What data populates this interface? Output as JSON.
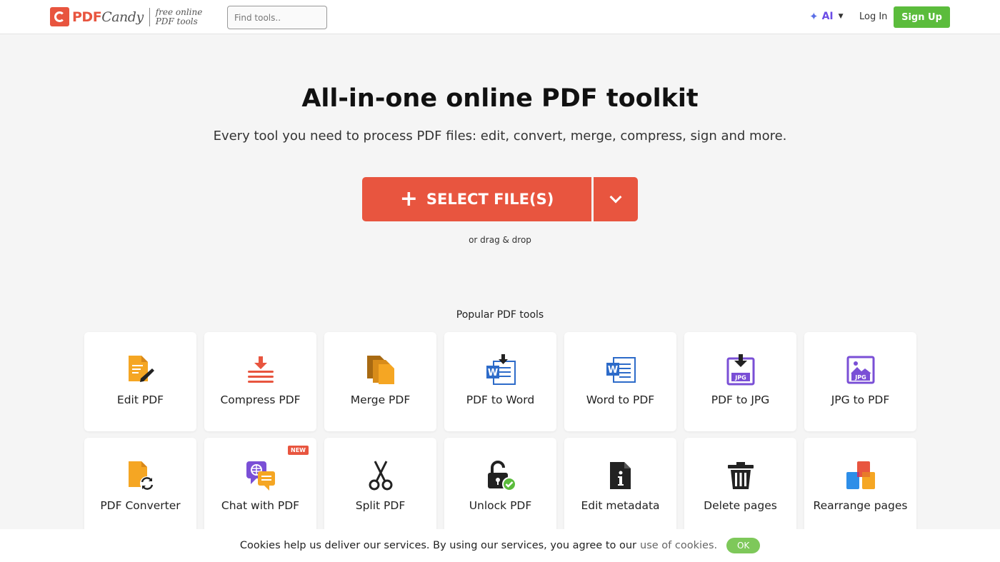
{
  "header": {
    "brand_name": "PDF",
    "brand_name2": "Candy",
    "tagline_line1": "free online",
    "tagline_line2": "PDF tools",
    "search_placeholder": "Find tools..",
    "ai_label": "AI",
    "login_label": "Log In",
    "signup_label": "Sign Up"
  },
  "hero": {
    "title": "All-in-one online PDF toolkit",
    "subtitle": "Every tool you need to process PDF files: edit, convert, merge, compress, sign and more.",
    "select_label": "SELECT FILE(S)",
    "drag_text": "or drag & drop"
  },
  "popular": {
    "heading": "Popular PDF tools",
    "tools": [
      {
        "label": "Edit PDF",
        "icon": "edit-pdf-icon"
      },
      {
        "label": "Compress PDF",
        "icon": "compress-pdf-icon"
      },
      {
        "label": "Merge PDF",
        "icon": "merge-pdf-icon"
      },
      {
        "label": "PDF to Word",
        "icon": "pdf-to-word-icon"
      },
      {
        "label": "Word to PDF",
        "icon": "word-to-pdf-icon"
      },
      {
        "label": "PDF to JPG",
        "icon": "pdf-to-jpg-icon"
      },
      {
        "label": "JPG to PDF",
        "icon": "jpg-to-pdf-icon"
      },
      {
        "label": "PDF Converter",
        "icon": "pdf-converter-icon"
      },
      {
        "label": "Chat with PDF",
        "icon": "chat-with-pdf-icon",
        "badge": "NEW"
      },
      {
        "label": "Split PDF",
        "icon": "scissors-icon"
      },
      {
        "label": "Unlock PDF",
        "icon": "unlock-icon"
      },
      {
        "label": "Edit metadata",
        "icon": "metadata-icon"
      },
      {
        "label": "Delete pages",
        "icon": "trash-icon"
      },
      {
        "label": "Rearrange pages",
        "icon": "rearrange-icon"
      }
    ]
  },
  "cookie": {
    "text": "Cookies help us deliver our services. By using our services, you agree to our",
    "link": "use of cookies.",
    "ok_label": "OK"
  },
  "colors": {
    "accent": "#e8553f",
    "signup": "#5bbc3c",
    "ai": "#6b4ce6",
    "ok": "#7ec85a"
  }
}
